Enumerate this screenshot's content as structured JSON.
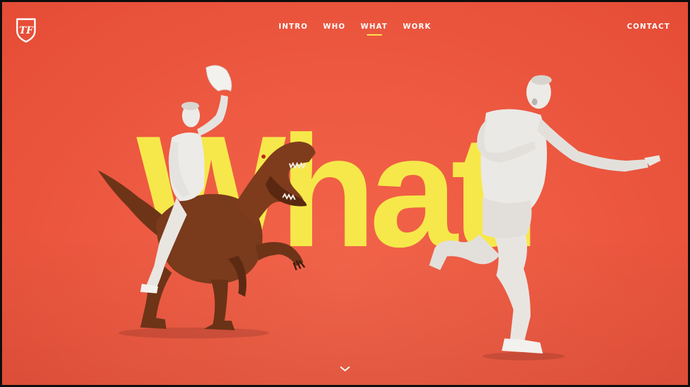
{
  "brand": {
    "logo_text": "TF"
  },
  "nav": {
    "items": [
      {
        "label": "INTRO",
        "active": false
      },
      {
        "label": "WHO",
        "active": false
      },
      {
        "label": "WHAT",
        "active": true
      },
      {
        "label": "WORK",
        "active": false
      }
    ],
    "contact_label": "CONTACT"
  },
  "hero": {
    "headline": "What."
  },
  "colors": {
    "background": "#ee5a42",
    "headline": "#f6e84a",
    "nav_text": "#ffffff",
    "active_underline": "#f7e94a",
    "figure_white": "#e8e6e2",
    "dinosaur": "#7a3a1c"
  },
  "icons": [
    "logo-shield-icon",
    "chevron-down-icon"
  ]
}
